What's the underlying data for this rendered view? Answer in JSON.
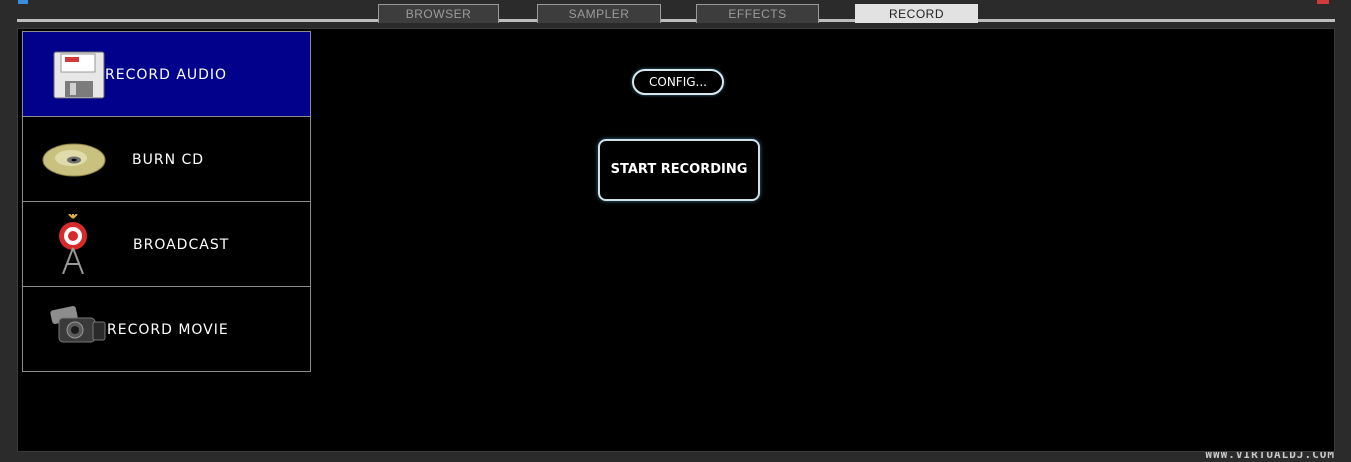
{
  "tabs": [
    {
      "label": "BROWSER",
      "active": false
    },
    {
      "label": "SAMPLER",
      "active": false
    },
    {
      "label": "EFFECTS",
      "active": false
    },
    {
      "label": "RECORD",
      "active": true
    }
  ],
  "sidebar": {
    "items": [
      {
        "label": "RECORD AUDIO",
        "icon": "floppy-disk-icon",
        "active": true
      },
      {
        "label": "BURN CD",
        "icon": "cd-disc-icon",
        "active": false
      },
      {
        "label": "BROADCAST",
        "icon": "broadcast-tower-icon",
        "active": false
      },
      {
        "label": "RECORD MOVIE",
        "icon": "video-camera-icon",
        "active": false
      }
    ]
  },
  "main": {
    "config_label": "CONFIG...",
    "start_label": "START RECORDING"
  },
  "footer": {
    "url": "WWW.VIRTUALDJ.COM"
  },
  "colors": {
    "active_item": "#01018c",
    "active_tab": "#e2e2e2",
    "background": "#000000"
  }
}
